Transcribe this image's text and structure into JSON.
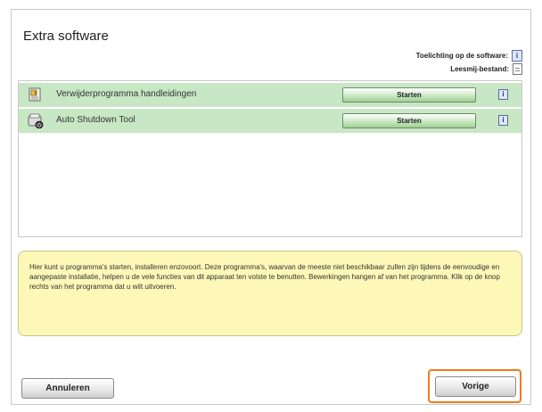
{
  "title": "Extra software",
  "legend": {
    "explanation_label": "Toelichting op de software:",
    "explanation_icon": "info-icon",
    "readme_label": "Leesmij-bestand:",
    "readme_icon": "document-icon"
  },
  "items": [
    {
      "name": "Verwijderprogramma handleidingen",
      "start_label": "Starten",
      "icon": "manual-uninstall-icon",
      "info_icon": "info-icon"
    },
    {
      "name": "Auto Shutdown Tool",
      "start_label": "Starten",
      "icon": "shutdown-tool-icon",
      "info_icon": "info-icon"
    }
  ],
  "help_text": "Hier kunt u programma's starten, installeren enzovoort. Deze programma's, waarvan de meeste niet beschikbaar zullen zijn tijdens de eenvoudige en aangepaste installatie, helpen u de vele functies van dit apparaat ten volste te benutten. Bewerkingen hangen af van het programma. Klik op de knop rechts van het programma dat u wilt uitvoeren.",
  "buttons": {
    "cancel": "Annuleren",
    "previous": "Vorige"
  },
  "colors": {
    "item_bg": "#c8e7c4",
    "help_bg": "#fdf8b8",
    "highlight": "#f07a1e"
  }
}
